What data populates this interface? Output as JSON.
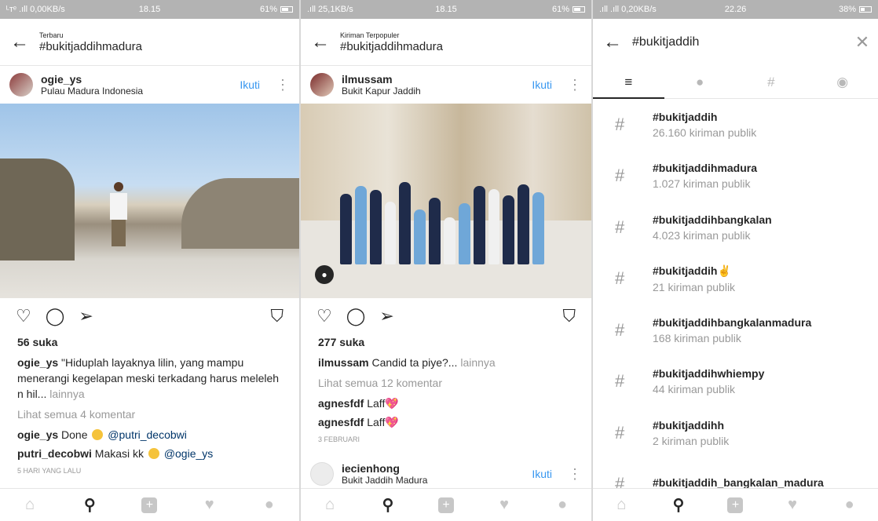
{
  "panel1": {
    "status": {
      "network": "ᴸᴛᵉ .ıll 0,00KB/s",
      "time": "18.15",
      "battery": "61%"
    },
    "header": {
      "subtitle": "Terbaru",
      "title": "#bukitjaddihmadura"
    },
    "post": {
      "username": "ogie_ys",
      "location": "Pulau Madura Indonesia",
      "follow": "Ikuti",
      "likes": "56 suka",
      "caption_user": "ogie_ys",
      "caption_line1": " \"Hiduplah layaknya lilin, yang mampu",
      "caption_line2": "menerangi kegelapan meski terkadang harus meleleh",
      "caption_line3": "n hil...",
      "caption_more": " lainnya",
      "view_comments": "Lihat semua 4 komentar",
      "comments": [
        {
          "user": "ogie_ys",
          "text": " Done ",
          "mention": "@putri_decobwi"
        },
        {
          "user": "putri_decobwi",
          "text": " Makasi kk ",
          "mention": "@ogie_ys"
        }
      ],
      "time": "5 HARI YANG LALU"
    }
  },
  "panel2": {
    "status": {
      "network": ".ıll 25,1KB/s",
      "time": "18.15",
      "battery": "61%"
    },
    "header": {
      "subtitle": "Kiriman Terpopuler",
      "title": "#bukitjaddihmadura"
    },
    "post": {
      "username": "ilmussam",
      "location": "Bukit Kapur Jaddih",
      "follow": "Ikuti",
      "likes": "277 suka",
      "caption_user": "ilmussam",
      "caption_text": " Candid ta piye?...",
      "caption_more": " lainnya",
      "view_comments": "Lihat semua 12 komentar",
      "comments": [
        {
          "user": "agnesfdf",
          "text": " Laff"
        },
        {
          "user": "agnesfdf",
          "text": " Laff"
        }
      ],
      "time": "3 FEBRUARI"
    },
    "next_post": {
      "username": "iecienhong",
      "location": "Bukit Jaddih Madura",
      "follow": "Ikuti"
    }
  },
  "panel3": {
    "status": {
      "network": ".ıll .ıll 0,20KB/s",
      "time": "22.26",
      "battery": "38%"
    },
    "search": {
      "query": "#bukitjaddih"
    },
    "tabs": [
      "top-icon",
      "people-icon",
      "tags-icon",
      "places-icon"
    ],
    "tags": [
      {
        "name": "#bukitjaddih",
        "count": "26.160 kiriman publik"
      },
      {
        "name": "#bukitjaddihmadura",
        "count": "1.027 kiriman publik"
      },
      {
        "name": "#bukitjaddihbangkalan",
        "count": "4.023 kiriman publik"
      },
      {
        "name": "#bukitjaddih✌",
        "count": "21 kiriman publik"
      },
      {
        "name": "#bukitjaddihbangkalanmadura",
        "count": "168 kiriman publik"
      },
      {
        "name": "#bukitjaddihwhiempy",
        "count": "44 kiriman publik"
      },
      {
        "name": "#bukitjaddihh",
        "count": "2 kiriman publik"
      },
      {
        "name": "#bukitjaddih_bangkalan_madura",
        "count": ""
      }
    ]
  },
  "nav_icons": [
    "home-icon",
    "search-icon",
    "add-post-icon",
    "activity-heart-icon",
    "profile-icon"
  ],
  "colors": {
    "accent": "#3897f0",
    "mention": "#003569",
    "status_bar": "#b3b3b3"
  }
}
